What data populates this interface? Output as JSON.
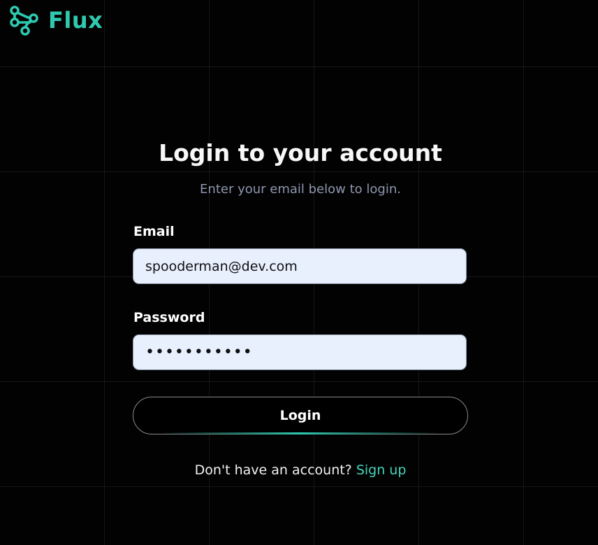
{
  "brand": {
    "name": "Flux",
    "icon": "network-nodes-icon",
    "color": "#2fc9b0"
  },
  "login": {
    "title": "Login to your account",
    "subtitle": "Enter your email below to login.",
    "email_label": "Email",
    "email_value": "spooderman@dev.com",
    "password_label": "Password",
    "password_value": "•••••••••••",
    "submit_label": "Login",
    "signup_prompt": "Don't have an account? ",
    "signup_link": "Sign up"
  },
  "colors": {
    "background": "#020202",
    "accent": "#2fc9b0",
    "input_background": "#e8f0fe",
    "subtitle": "#8d97ae"
  }
}
